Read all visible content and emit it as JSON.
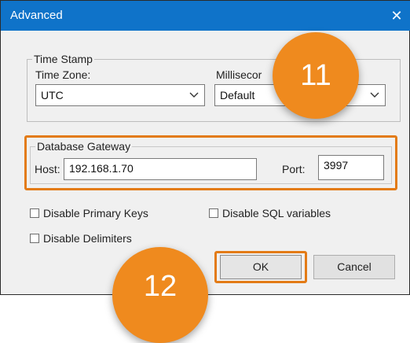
{
  "dialog": {
    "title": "Advanced",
    "close_glyph": "✕"
  },
  "time_stamp": {
    "group_label": "Time Stamp",
    "time_zone_label": "Time Zone:",
    "time_zone_value": "UTC",
    "milliseconds_label": "Millisecor",
    "milliseconds_value": "Default"
  },
  "database_gateway": {
    "group_label": "Database Gateway",
    "host_label": "Host:",
    "host_value": "192.168.1.70",
    "port_label": "Port:",
    "port_value": "3997"
  },
  "options": {
    "disable_primary_keys": "Disable Primary Keys",
    "disable_sql_variables": "Disable SQL variables",
    "disable_delimiters": "Disable Delimiters"
  },
  "buttons": {
    "ok": "OK",
    "cancel": "Cancel"
  },
  "callouts": {
    "step_11": "11",
    "step_12": "12"
  },
  "colors": {
    "titlebar": "#0f73c9",
    "highlight": "#e37b16",
    "callout": "#ef8a1e"
  }
}
